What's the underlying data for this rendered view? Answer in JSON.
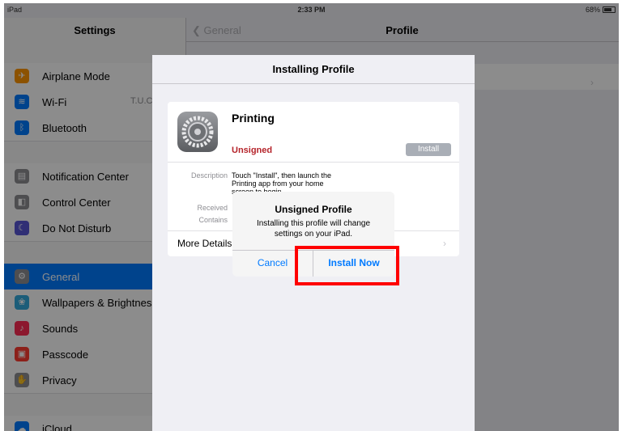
{
  "status_bar": {
    "device": "iPad",
    "time": "2:33 PM",
    "battery": "68%"
  },
  "sidebar": {
    "title": "Settings",
    "items": [
      {
        "label": "Airplane Mode",
        "icon": "airplane-icon",
        "color": "#ff9500"
      },
      {
        "label": "Wi-Fi",
        "value": "T.U.C",
        "icon": "wifi-icon",
        "color": "#007aff"
      },
      {
        "label": "Bluetooth",
        "icon": "bluetooth-icon",
        "color": "#007aff"
      },
      {
        "label": "Notification Center",
        "icon": "notification-center-icon",
        "color": "#8e8e93"
      },
      {
        "label": "Control Center",
        "icon": "control-center-icon",
        "color": "#8e8e93"
      },
      {
        "label": "Do Not Disturb",
        "icon": "moon-icon",
        "color": "#5856d6"
      },
      {
        "label": "General",
        "icon": "gear-icon",
        "color": "#8e8e93",
        "selected": true
      },
      {
        "label": "Wallpapers & Brightness",
        "icon": "wallpaper-icon",
        "color": "#34aadc"
      },
      {
        "label": "Sounds",
        "icon": "speaker-icon",
        "color": "#ff2d55"
      },
      {
        "label": "Passcode",
        "icon": "lock-icon",
        "color": "#ff3b30"
      },
      {
        "label": "Privacy",
        "icon": "hand-icon",
        "color": "#8e8e93"
      },
      {
        "label": "iCloud",
        "icon": "cloud-icon",
        "color": "#007aff"
      }
    ]
  },
  "header": {
    "back_label": "General",
    "title": "Profile"
  },
  "sheet": {
    "title": "Installing Profile",
    "profile_name": "Printing",
    "signed_status": "Unsigned",
    "install_label": "Install",
    "description_label": "Description",
    "description_text": "Touch \"Install\", then launch the Printing app from your home screen to begin.",
    "received_label": "Received",
    "contains_label": "Contains",
    "more_details_label": "More Details"
  },
  "alert": {
    "title": "Unsigned Profile",
    "message": "Installing this profile will change settings on your iPad.",
    "cancel_label": "Cancel",
    "confirm_label": "Install Now"
  },
  "colors": {
    "accent": "#007aff",
    "unsigned": "#b5232a",
    "highlight": "#ff0000"
  }
}
